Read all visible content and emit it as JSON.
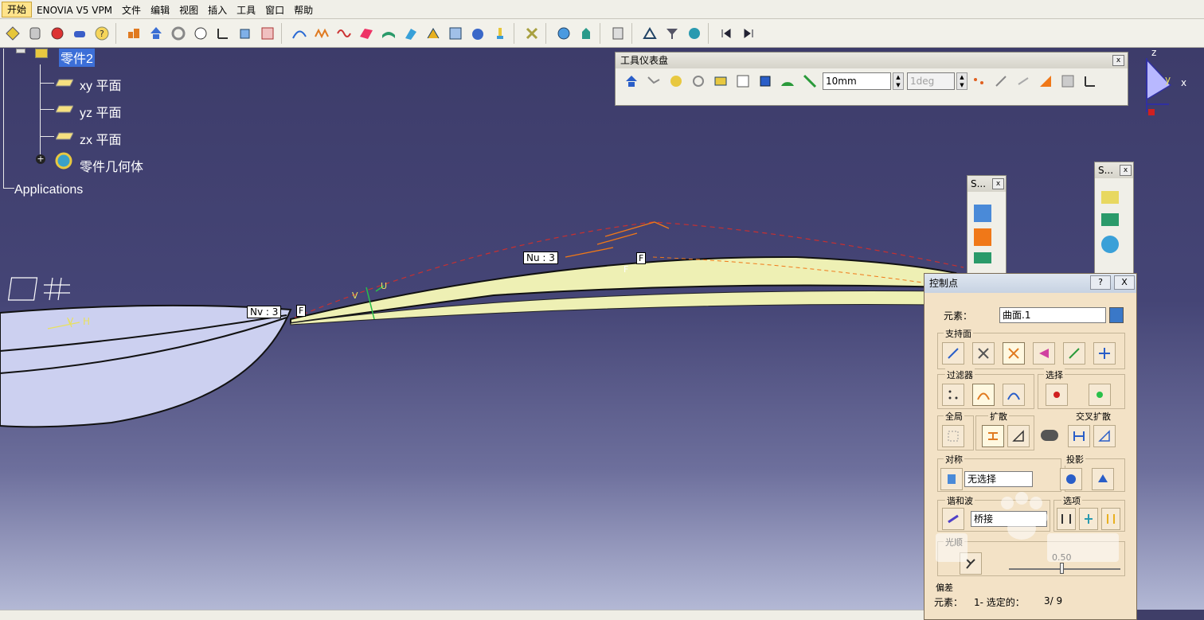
{
  "menu": {
    "items": [
      "开始",
      "ENOVIA V5 VPM",
      "文件",
      "编辑",
      "视图",
      "插入",
      "工具",
      "窗口",
      "帮助"
    ]
  },
  "tree": {
    "root": "零件2",
    "children": [
      "xy 平面",
      "yz 平面",
      "zx 平面",
      "零件几何体"
    ],
    "applications": "Applications"
  },
  "viewport_labels": {
    "nu": "Nu : 3",
    "nv": "Nv : 3",
    "f1": "F",
    "f2": "F",
    "f3": "F",
    "axis_v": "V",
    "axis_u": "U",
    "local_v": "V",
    "local_h": "H",
    "compass_x": "x",
    "compass_y": "y",
    "compass_z": "z"
  },
  "dashboard": {
    "title": "工具仪表盘",
    "step_value": "10mm",
    "angle_value": "1deg",
    "close": "x"
  },
  "mini_toolbars": {
    "a_title": "S...",
    "b_title": "S...",
    "close": "x"
  },
  "dialog": {
    "title": "控制点",
    "help": "?",
    "close": "X",
    "element_label": "元素：",
    "element_value": "曲面.1",
    "support": "支持面",
    "filter": "过滤器",
    "select": "选择",
    "global": "全局",
    "diffuse": "扩散",
    "cross_diffuse": "交叉扩散",
    "symmetry": "对称",
    "symmetry_value": "无选择",
    "projection": "投影",
    "harmonic": "谐和波",
    "harmonic_value": "桥接",
    "options": "选项",
    "smooth": "光顺",
    "smooth_value": "0.50",
    "offset": "偏差",
    "status_label": "元素：",
    "status_value": "1- 选定的：",
    "status_count": "3/ 9"
  },
  "colors": {
    "viewport_top": "#3d3c6a",
    "surface_fill": "#eef0b4",
    "dialog_bg": "#f3e2c6",
    "selection": "#3c6fd8"
  }
}
